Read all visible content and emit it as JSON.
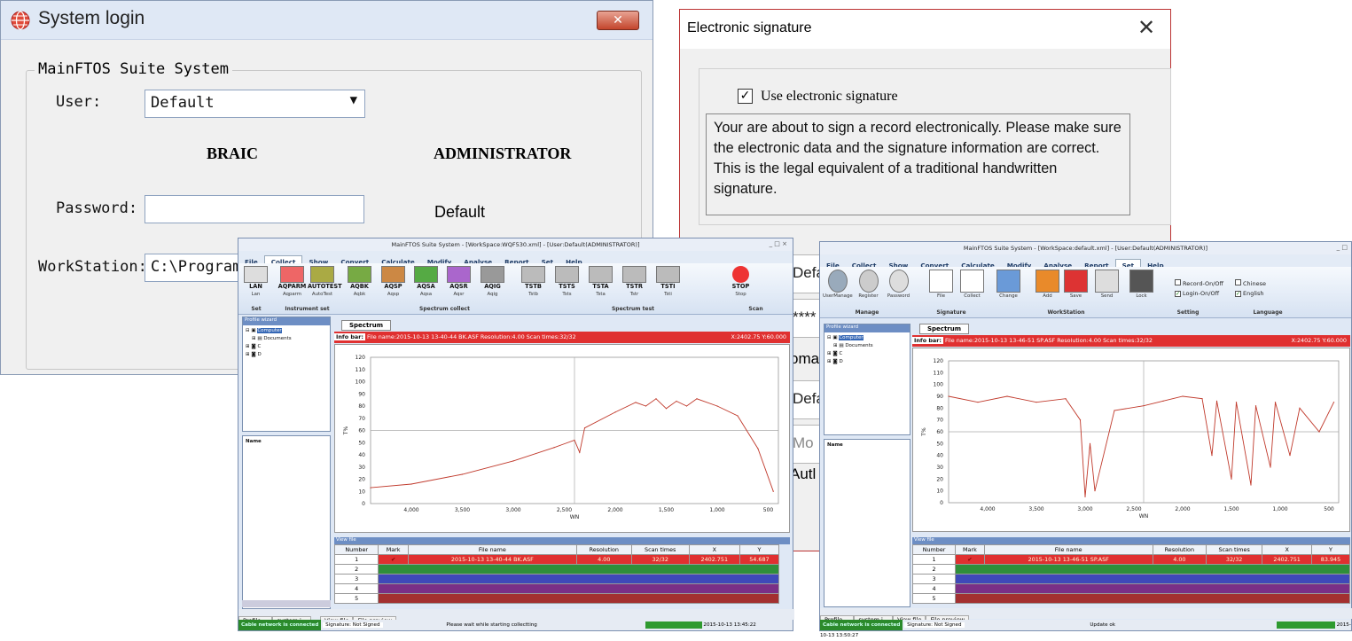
{
  "login": {
    "title": "System login",
    "close": "✕",
    "group": "MainFTOS Suite System",
    "user_label": "User:",
    "user_value": "Default",
    "braic": "BRAIC",
    "admin": "ADMINISTRATOR",
    "password_label": "Password:",
    "password_value": "",
    "default_text": "Default",
    "ws_label": "WorkStation:",
    "ws_value": "C:\\Program"
  },
  "esig": {
    "title": "Electronic signature",
    "use_label": "Use electronic signature",
    "note": "Your are about to sign a record electronically. Please make sure the electronic data and the signature information are correct. This is the legal equivalent of a traditional handwritten signature.",
    "peek": [
      "Defa",
      "****",
      "omat",
      "Defa",
      "Mo",
      "Autl"
    ]
  },
  "app1": {
    "title": "MainFTOS Suite System - [WorkSpace:WQF530.xml] - [User:Default(ADMINISTRATOR)]",
    "win_buttons": "_ □ ×",
    "menu": [
      "File",
      "Collect",
      "Show",
      "Convert",
      "Calculate",
      "Modify",
      "Analyse",
      "Report",
      "Set",
      "Help"
    ],
    "active_menu": "Collect",
    "buttons": [
      {
        "l1": "LAN",
        "l2": "Lan"
      },
      {
        "l1": "AQPARM",
        "l2": "Aqparm"
      },
      {
        "l1": "AUTOTEST",
        "l2": "AutoTest"
      },
      {
        "l1": "AQBK",
        "l2": "Aqbk"
      },
      {
        "l1": "AQSP",
        "l2": "Aqsp"
      },
      {
        "l1": "AQSA",
        "l2": "Aqsa"
      },
      {
        "l1": "AQSR",
        "l2": "Aqsr"
      },
      {
        "l1": "AQIG",
        "l2": "Aqig"
      },
      {
        "l1": "TSTB",
        "l2": "Tstb"
      },
      {
        "l1": "TSTS",
        "l2": "Tsts"
      },
      {
        "l1": "TSTA",
        "l2": "Tsta"
      },
      {
        "l1": "TSTR",
        "l2": "Tstr"
      },
      {
        "l1": "TSTI",
        "l2": "Tsti"
      },
      {
        "l1": "STOP",
        "l2": "Stop"
      }
    ],
    "groups": [
      "Set",
      "Instrument set",
      "Spectrum collect",
      "Spectrum test",
      "Scan"
    ],
    "profile_title": "Profile wizard",
    "tree": [
      "Computer",
      "Documents",
      "C",
      "D"
    ],
    "name_header": "Name",
    "tab": "Spectrum",
    "info_label": "Info bar:",
    "info_text": "File name:2015-10-13 13-40-44 BK.ASF    Resolution:4.00    Scan times:32/32",
    "coords": "X:2402.75 Y:60.000",
    "viewfile": "View file",
    "table_headers": [
      "Number",
      "Mark",
      "File name",
      "Resolution",
      "Scan times",
      "X",
      "Y"
    ],
    "row1": [
      "1",
      "✔",
      "2015-10-13 13-40-44 BK.ASF",
      "4.00",
      "32/32",
      "2402.751",
      "54.687"
    ],
    "row_numbers": [
      "2",
      "3",
      "4",
      "5"
    ],
    "bottom_tabs": [
      "Profile ...",
      "system i...",
      "View file",
      "File preview"
    ],
    "status_conn": "Cable network is connected",
    "status_sig": "Signature: Not Signed",
    "status_msg": "Please wait while starting collectting",
    "status_time": "2015-10-13 13:45:22"
  },
  "app2": {
    "title": "MainFTOS Suite System - [WorkSpace:default.xml] - [User:Default(ADMINISTRATOR)]",
    "win_buttons": "_ □",
    "menu": [
      "File",
      "Collect",
      "Show",
      "Convert",
      "Calculate",
      "Modify",
      "Analyse",
      "Report",
      "Set",
      "Help"
    ],
    "active_menu": "Set",
    "buttons": [
      "UserManage",
      "Register",
      "Password",
      "File",
      "Collect",
      "Change",
      "Add",
      "Save",
      "Send",
      "Lock"
    ],
    "checks": [
      {
        "label": "Record-On/Off",
        "checked": false
      },
      {
        "label": "Login-On/Off",
        "checked": true
      },
      {
        "label": "Chinese",
        "checked": false
      },
      {
        "label": "English",
        "checked": true
      }
    ],
    "groups": [
      "Manage",
      "Signature",
      "WorkStation",
      "Setting",
      "Language"
    ],
    "profile_title": "Profile wizard",
    "tree": [
      "Computer",
      "Documents",
      "C",
      "D"
    ],
    "name_header": "Name",
    "tab": "Spectrum",
    "info_label": "Info bar:",
    "info_text": "File name:2015-10-13 13-46-51 SP.ASF    Resolution:4.00    Scan times:32/32",
    "coords": "X:2402.75 Y:60.000",
    "viewfile": "View file",
    "table_headers": [
      "Number",
      "Mark",
      "File name",
      "Resolution",
      "Scan times",
      "X",
      "Y"
    ],
    "row1": [
      "1",
      "✔",
      "2015-10-13 13-46-51 SP.ASF",
      "4.00",
      "32/32",
      "2402.751",
      "83.945"
    ],
    "row_numbers": [
      "2",
      "3",
      "4",
      "5"
    ],
    "bottom_tabs": [
      "Profile ...",
      "system i...",
      "View file",
      "File preview"
    ],
    "status_conn": "Cable network is connected",
    "status_sig": "Signature: Not Signed",
    "status_msg": "Update ok",
    "status_time": "2015-10-13 13:50:27"
  },
  "row_colors": [
    "#e03030",
    "#2f8f3a",
    "#3f49b8",
    "#7a2f86",
    "#a33030"
  ],
  "chart_data": [
    {
      "type": "line",
      "xlabel": "WN",
      "ylabel": "T%",
      "xlim": [
        4400,
        400
      ],
      "ylim": [
        0,
        120
      ],
      "x_ticks": [
        "4,000",
        "3,500",
        "3,000",
        "2,500",
        "2,000",
        "1,500",
        "1,000",
        "500"
      ],
      "y_ticks": [
        "0",
        "10",
        "20",
        "30",
        "40",
        "50",
        "60",
        "70",
        "80",
        "90",
        "100",
        "110",
        "120"
      ],
      "x": [
        4400,
        4000,
        3500,
        3000,
        2600,
        2400,
        2350,
        2300,
        2000,
        1800,
        1700,
        1600,
        1500,
        1400,
        1300,
        1200,
        1000,
        800,
        600,
        450
      ],
      "y": [
        13,
        16,
        24,
        35,
        46,
        52,
        42,
        62,
        75,
        83,
        80,
        86,
        78,
        84,
        80,
        86,
        80,
        72,
        45,
        10
      ]
    },
    {
      "type": "line",
      "xlabel": "WN",
      "ylabel": "T%",
      "xlim": [
        4400,
        400
      ],
      "ylim": [
        0,
        120
      ],
      "x_ticks": [
        "4,000",
        "3,500",
        "3,000",
        "2,500",
        "2,000",
        "1,500",
        "1,000",
        "500"
      ],
      "y_ticks": [
        "0",
        "10",
        "20",
        "30",
        "40",
        "50",
        "60",
        "70",
        "80",
        "90",
        "100",
        "110",
        "120"
      ],
      "x": [
        4400,
        4100,
        3800,
        3500,
        3200,
        3050,
        3000,
        2950,
        2900,
        2700,
        2400,
        2200,
        2000,
        1800,
        1700,
        1650,
        1500,
        1450,
        1300,
        1250,
        1100,
        1050,
        900,
        800,
        600,
        450
      ],
      "y": [
        90,
        85,
        90,
        85,
        88,
        70,
        5,
        50,
        10,
        78,
        82,
        86,
        90,
        88,
        40,
        86,
        20,
        85,
        15,
        82,
        30,
        85,
        40,
        80,
        60,
        85
      ]
    }
  ]
}
